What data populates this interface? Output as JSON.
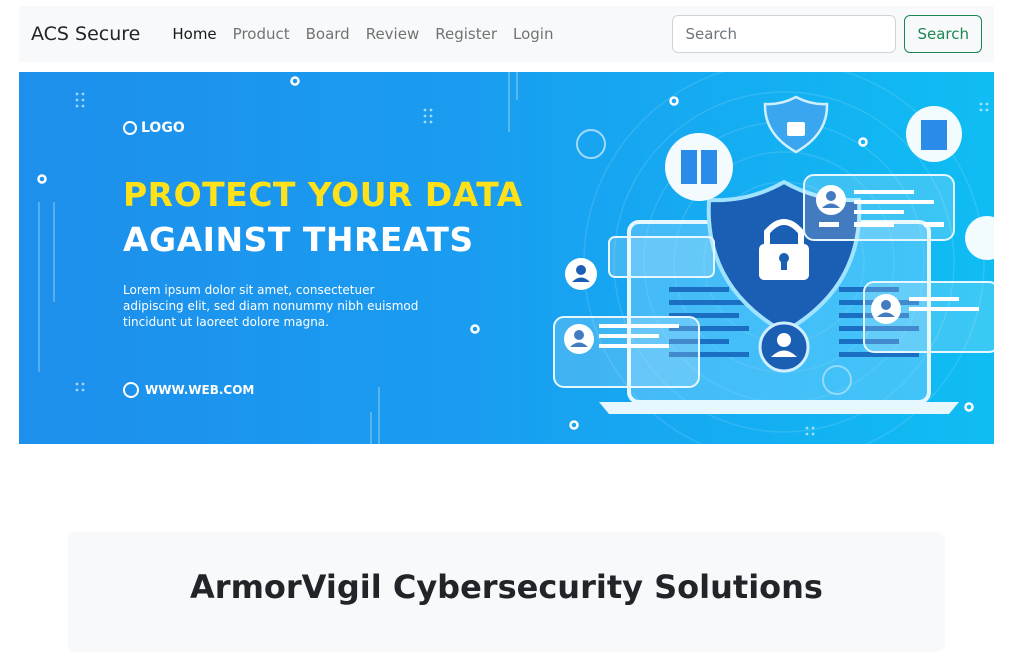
{
  "navbar": {
    "brand": "ACS Secure",
    "items": [
      {
        "label": "Home",
        "active": true
      },
      {
        "label": "Product"
      },
      {
        "label": "Board"
      },
      {
        "label": "Review"
      },
      {
        "label": "Register"
      },
      {
        "label": "Login"
      }
    ],
    "search": {
      "placeholder": "Search",
      "button_label": "Search"
    }
  },
  "banner": {
    "logo_text": "LOGO",
    "headline_line1": "PROTECT YOUR DATA",
    "headline_line2": "AGAINST THREATS",
    "body_text": "Lorem ipsum dolor sit amet, consectetuer adipiscing elit, sed diam nonummy nibh euismod tincidunt ut laoreet dolore magna.",
    "website": "WWW.WEB.COM",
    "colors": {
      "headline_yellow": "#ffe11a",
      "bg_blue": "#1d8fec"
    }
  },
  "main": {
    "title": "ArmorVigil Cybersecurity Solutions"
  },
  "colors": {
    "accent_green": "#198754",
    "navbar_bg": "#f8f9fa"
  }
}
